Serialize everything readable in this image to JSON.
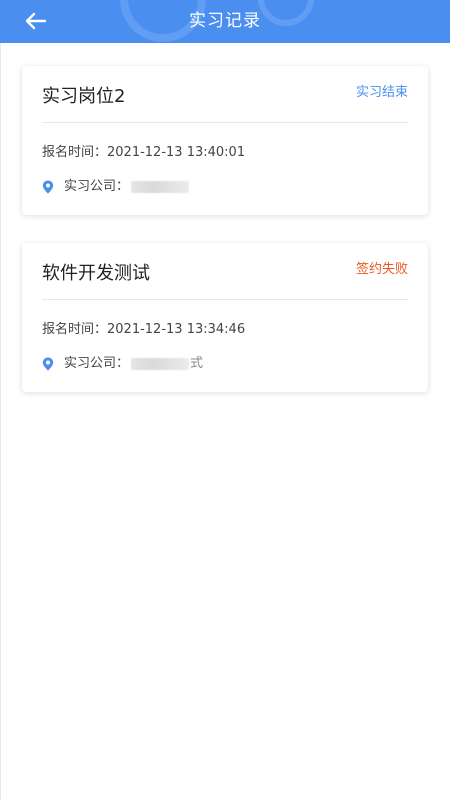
{
  "header": {
    "title": "实习记录",
    "back_icon": "arrow-left-icon",
    "color": "#4a8ff0"
  },
  "records": [
    {
      "position": "实习岗位2",
      "status": "实习结束",
      "status_color": "#4a8ff0",
      "signup_label": "报名时间：",
      "signup_time": "2021-12-13 13:40:01",
      "company_label": "实习公司：",
      "company_suffix": ""
    },
    {
      "position": "软件开发测试",
      "status": "签约失败",
      "status_color": "#ea5a1f",
      "signup_label": "报名时间：",
      "signup_time": "2021-12-13 13:34:46",
      "company_label": "实习公司：",
      "company_suffix": "式"
    }
  ]
}
